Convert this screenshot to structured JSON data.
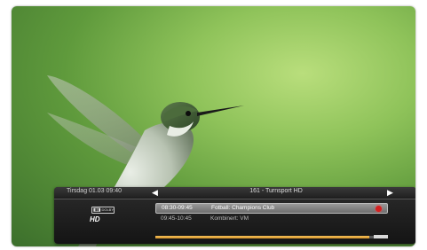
{
  "banner": {
    "datetime": "Tirsdag 01.03 09:40",
    "channel": "161 - Turnsport HD",
    "audio_badge": "DOLBY",
    "video_badge": "HD",
    "programs": [
      {
        "time": "08:30-09:45",
        "title": "Fotball: Champions Club",
        "selected": true,
        "recording": true
      },
      {
        "time": "09:45-10:45",
        "title": "Kombinert: VM",
        "selected": false,
        "recording": false
      }
    ],
    "progress": 0.92,
    "colors": {
      "progress_fill": "#e0a030",
      "record_indicator": "#d42020"
    },
    "icons": {
      "prev": "chevron-left-icon",
      "next": "chevron-right-icon",
      "record": "record-icon"
    }
  }
}
